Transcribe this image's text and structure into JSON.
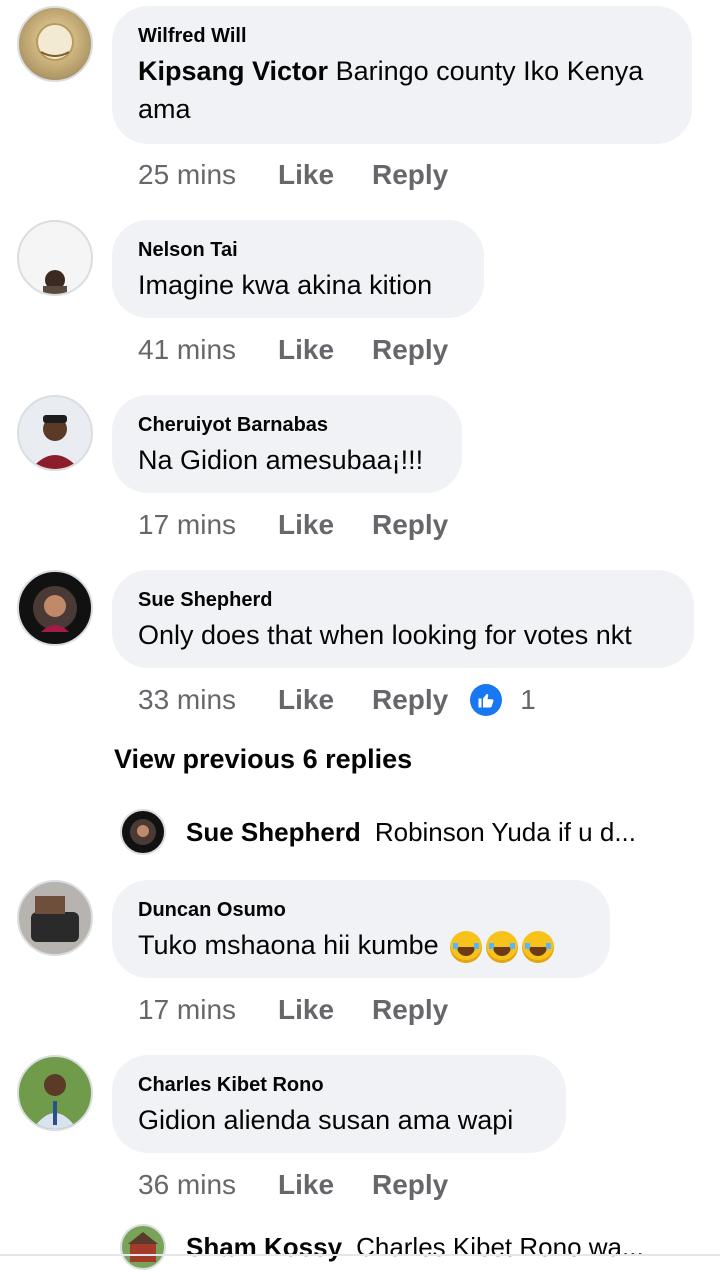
{
  "comments": [
    {
      "author": "Wilfred Will",
      "mention": "Kipsang Victor",
      "text": "Baringo county Iko Kenya ama",
      "time": "25 mins",
      "like": "Like",
      "reply": "Reply"
    },
    {
      "author": "Nelson Tai",
      "text": "Imagine kwa akina kition",
      "time": "41 mins",
      "like": "Like",
      "reply": "Reply"
    },
    {
      "author": "Cheruiyot Barnabas",
      "text": "Na Gidion amesubaa¡!!!",
      "time": "17 mins",
      "like": "Like",
      "reply": "Reply"
    },
    {
      "author": "Sue Shepherd",
      "text": "Only does that when looking for votes nkt",
      "time": "33 mins",
      "like": "Like",
      "reply": "Reply",
      "reaction_count": "1"
    },
    {
      "author": "Duncan Osumo",
      "text": "Tuko mshaona hii kumbe",
      "time": "17 mins",
      "like": "Like",
      "reply": "Reply"
    },
    {
      "author": "Charles Kibet Rono",
      "text": "Gidion alienda susan ama wapi",
      "time": "36 mins",
      "like": "Like",
      "reply": "Reply"
    }
  ],
  "view_previous": "View previous 6 replies",
  "reply_previews": [
    {
      "name": "Sue Shepherd",
      "text": "Robinson Yuda if u d..."
    },
    {
      "name": "Sham Kossy",
      "text": "Charles Kibet Rono wa..."
    }
  ],
  "icons": {
    "reaction": "like-thumb-icon",
    "emoji": "face-with-tears-of-joy"
  },
  "colors": {
    "bubble": "#f0f2f5",
    "meta": "#65676b",
    "like_blue": "#1877f2"
  }
}
